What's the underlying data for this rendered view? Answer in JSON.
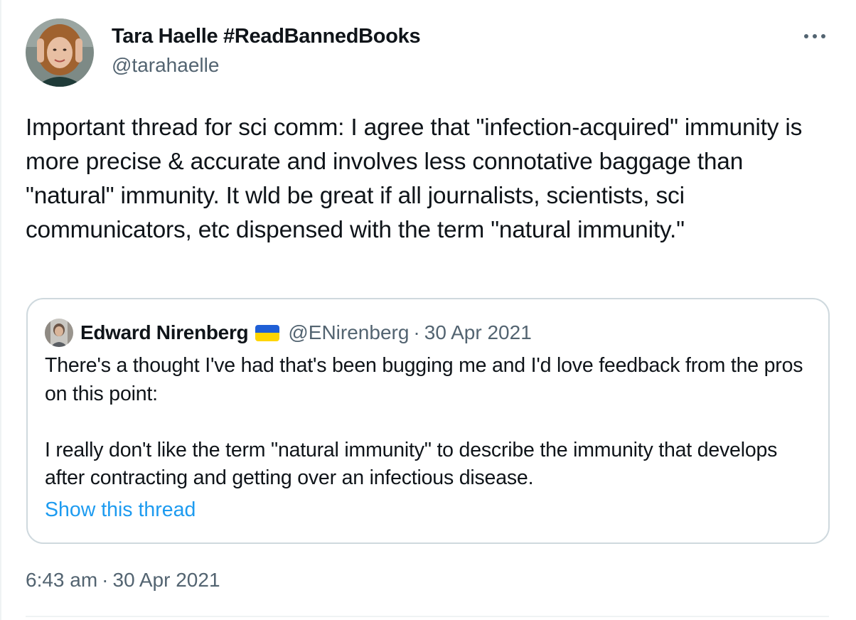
{
  "author": {
    "display_name": "Tara Haelle #ReadBannedBooks",
    "handle": "@tarahaelle",
    "avatar_icon": "profile-photo-avatar"
  },
  "more_icon": "more-horizontal-icon",
  "tweet": {
    "text": "Important thread for sci comm: I agree that \"infection-acquired\" immunity is more precise & accurate and involves less connotative baggage than \"natural\" immunity. It wld be great if all journalists, scientists, sci communicators, etc dispensed with the term \"natural immunity.\""
  },
  "quoted_tweet": {
    "display_name": "Edward Nirenberg",
    "flag_icon": "ukraine-flag-icon",
    "handle": "@ENirenberg",
    "separator": "·",
    "date": "30 Apr 2021",
    "text": "There's a thought I've had that's been bugging me and I'd love feedback from the pros on this point:\n\nI really don't like the term \"natural immunity\" to describe the immunity that develops after contracting and getting over an infectious disease.",
    "show_thread_label": "Show this thread"
  },
  "timestamp": {
    "time": "6:43 am",
    "separator": "·",
    "date": "30 Apr 2021"
  },
  "colors": {
    "text_primary": "#0f1419",
    "text_secondary": "#536471",
    "link_blue": "#1d9bf0",
    "border": "#cfd9de"
  }
}
